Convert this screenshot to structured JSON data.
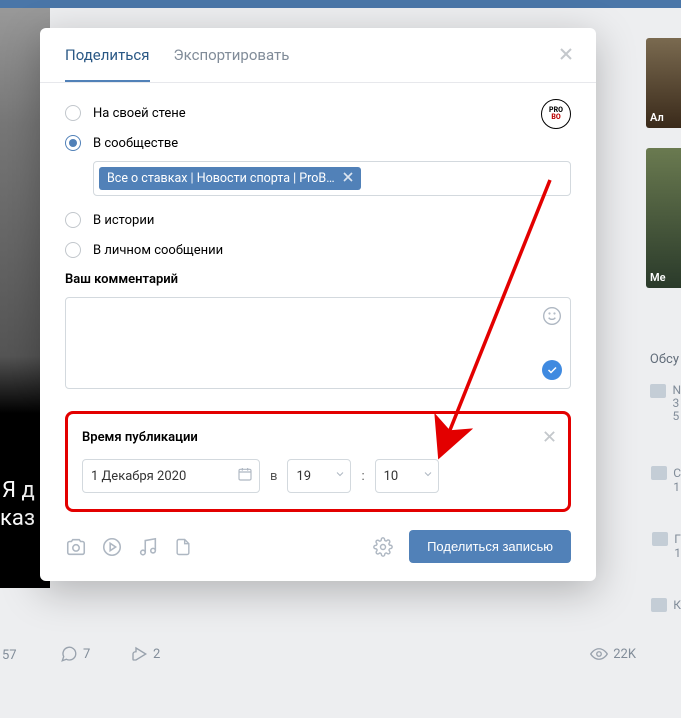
{
  "tabs": {
    "share": "Поделиться",
    "export": "Экспортировать"
  },
  "radios": {
    "on_wall": "На своей стене",
    "in_community": "В сообществе",
    "in_story": "В истории",
    "in_message": "В личном сообщении"
  },
  "community_chip": "Все о ставках | Новости спорта | ProB…",
  "comment_label": "Ваш комментарий",
  "schedule": {
    "title": "Время публикации",
    "date": "1 Декабря 2020",
    "at": "в",
    "hour": "19",
    "colon": ":",
    "minute": "10"
  },
  "submit": "Поделиться записью",
  "avatar": {
    "line1": "PRO",
    "line2": "BO"
  },
  "bg": {
    "likes": "57",
    "comments": "7",
    "shares": "2",
    "views": "22K",
    "discuss": "Обсу",
    "thumb1": "Ал",
    "thumb2": "Me",
    "ya": "Я д",
    "kaz": "каз"
  }
}
